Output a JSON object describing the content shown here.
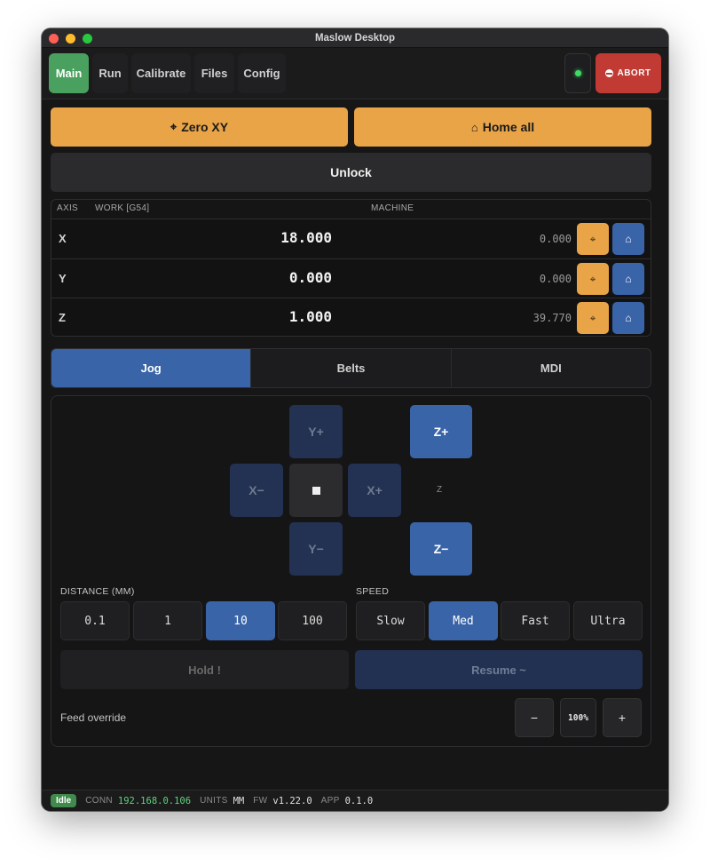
{
  "window": {
    "title": "Maslow Desktop"
  },
  "nav": {
    "tabs": [
      {
        "label": "Main"
      },
      {
        "label": "Run"
      },
      {
        "label": "Calibrate"
      },
      {
        "label": "Files"
      },
      {
        "label": "Config"
      }
    ],
    "abort_label": "ABORT",
    "connection_color": "#3ddc63"
  },
  "actions": {
    "zero_xy": "Zero XY",
    "home_all": "Home all",
    "unlock": "Unlock"
  },
  "dro": {
    "headers": {
      "axis": "AXIS",
      "work": "WORK [G54]",
      "machine": "MACHINE"
    },
    "rows": [
      {
        "axis": "X",
        "work": "18.000",
        "machine": "0.000"
      },
      {
        "axis": "Y",
        "work": "0.000",
        "machine": "0.000"
      },
      {
        "axis": "Z",
        "work": "1.000",
        "machine": "39.770"
      }
    ]
  },
  "panels": {
    "tabs": [
      {
        "label": "Jog"
      },
      {
        "label": "Belts"
      },
      {
        "label": "MDI"
      }
    ],
    "active": "Jog"
  },
  "jog": {
    "y_plus": "Y+",
    "y_minus": "Y−",
    "x_minus": "X−",
    "x_plus": "X+",
    "z_plus": "Z+",
    "z_minus": "Z−",
    "z_label": "Z",
    "distance_label": "DISTANCE (MM)",
    "distances": [
      "0.1",
      "1",
      "10",
      "100"
    ],
    "distance_selected": "10",
    "speed_label": "SPEED",
    "speeds": [
      "Slow",
      "Med",
      "Fast",
      "Ultra"
    ],
    "speed_selected": "Med",
    "hold_label": "Hold !",
    "resume_label": "Resume ~",
    "feed_label": "Feed override",
    "feed_minus": "−",
    "feed_value": "100%",
    "feed_plus": "+"
  },
  "status": {
    "state": "Idle",
    "conn_key": "CONN",
    "conn_value": "192.168.0.106",
    "units_key": "UNITS",
    "units_value": "MM",
    "fw_key": "FW",
    "fw_value": "v1.22.0",
    "app_key": "APP",
    "app_value": "0.1.0"
  },
  "colors": {
    "main_tab": "#4aa05f",
    "abort": "#c23a34",
    "orange": "#e9a447",
    "blue": "#3a64a8"
  }
}
